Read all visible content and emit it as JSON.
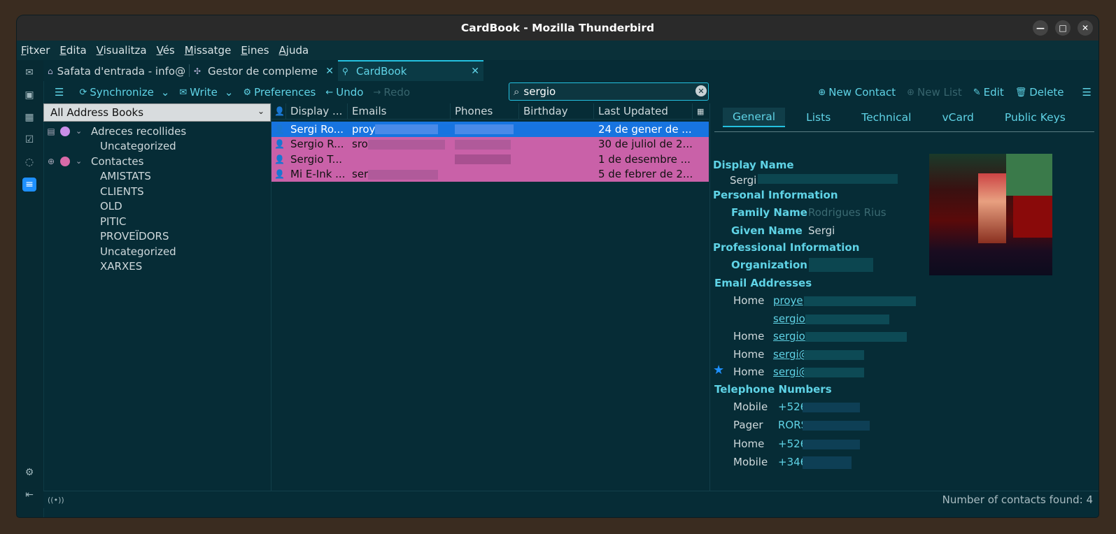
{
  "window": {
    "title": "CardBook - Mozilla Thunderbird"
  },
  "menubar": [
    "Fitxer",
    "Edita",
    "Visualitza",
    "Vés",
    "Missatge",
    "Eines",
    "Ajuda"
  ],
  "tabs": [
    {
      "label": "Safata d'entrada - info@",
      "icon": "inbox-icon"
    },
    {
      "label": "Gestor de compleme",
      "icon": "puzzle-icon"
    },
    {
      "label": "CardBook",
      "icon": "contacts-icon"
    }
  ],
  "toolbar": {
    "synchronize": "Synchronize",
    "write": "Write",
    "preferences": "Preferences",
    "undo": "Undo",
    "redo": "Redo"
  },
  "search": {
    "value": "sergio"
  },
  "right_toolbar": {
    "new_contact": "New Contact",
    "new_list": "New List",
    "edit": "Edit",
    "delete": "Delete"
  },
  "address_books": {
    "selected": "All Address Books",
    "books": [
      {
        "name": "Adreces recollides",
        "color": "#c98ee8",
        "groups": [
          "Uncategorized"
        ]
      },
      {
        "name": "Contactes",
        "color": "#d86aa8",
        "groups": [
          "AMISTATS",
          "CLIENTS",
          "OLD",
          "PITIC",
          "PROVEÏDORS",
          "Uncategorized",
          "XARXES"
        ]
      }
    ]
  },
  "contacts_table": {
    "columns": [
      "Display ...",
      "Emails",
      "Phones",
      "Birthday",
      "Last Updated"
    ],
    "rows": [
      {
        "name": "Sergi Ro...",
        "email": "proy",
        "updated": "24 de gener de ...",
        "state": "selected"
      },
      {
        "name": "Sergio R...",
        "email": "sro",
        "updated": "30 de juliol de 2...",
        "state": "pink"
      },
      {
        "name": "Sergio T...",
        "email": "",
        "updated": "1 de desembre ...",
        "state": "pink"
      },
      {
        "name": "Mi E-Ink ...",
        "email": "ser",
        "updated": "5 de febrer de 2...",
        "state": "pink"
      }
    ]
  },
  "details": {
    "tabs": [
      "General",
      "Lists",
      "Technical",
      "vCard",
      "Public Keys"
    ],
    "display_name_label": "Display Name",
    "display_name_value": "Sergi",
    "personal_info": "Personal Information",
    "family_name_label": "Family Name",
    "family_name_value": "Rodrigues Rius",
    "given_name_label": "Given Name",
    "given_name_value": "Sergi",
    "professional_info": "Professional Information",
    "organization_label": "Organization",
    "email_section": "Email Addresses",
    "emails": [
      {
        "type": "Home",
        "value": "proye"
      },
      {
        "type": "",
        "value": "sergio"
      },
      {
        "type": "Home",
        "value": "sergio"
      },
      {
        "type": "Home",
        "value": "sergi@"
      },
      {
        "type": "Home",
        "value": "sergi@"
      }
    ],
    "phone_section": "Telephone Numbers",
    "phones": [
      {
        "type": "Mobile",
        "value": "+526"
      },
      {
        "type": "Pager",
        "value": "RORS"
      },
      {
        "type": "Home",
        "value": "+526"
      },
      {
        "type": "Mobile",
        "value": "+346"
      }
    ]
  },
  "status": {
    "count_text": "Number of contacts found: 4"
  }
}
